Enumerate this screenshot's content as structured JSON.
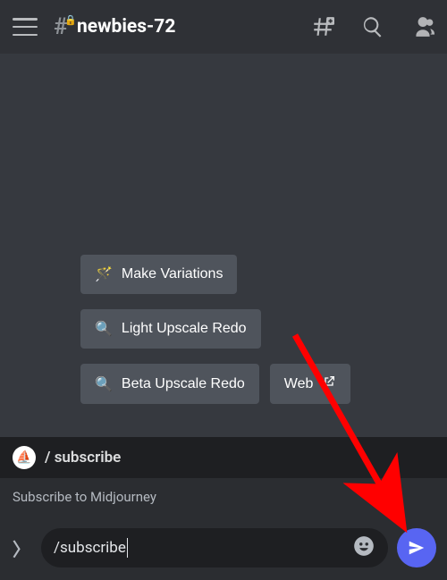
{
  "header": {
    "channel_name": "newbies-72"
  },
  "buttons": {
    "make_variations": "Make Variations",
    "light_upscale": "Light Upscale Redo",
    "beta_upscale": "Beta Upscale Redo",
    "web": "Web"
  },
  "icons": {
    "wand": "🪄",
    "magnifier": "🔍",
    "external": "↗"
  },
  "command_suggestion": {
    "name": "/ subscribe",
    "description": "Subscribe to Midjourney",
    "bot_avatar_glyph": "⛵"
  },
  "input": {
    "typed_text": "/subscribe"
  },
  "colors": {
    "accent": "#5865f2",
    "arrow": "#ff0000"
  }
}
